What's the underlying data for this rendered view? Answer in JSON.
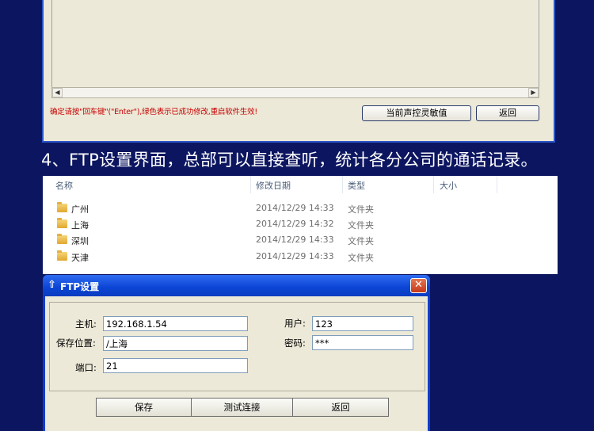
{
  "top_window": {
    "notice_text": "确定请按\"回车键\"(\"Enter\"),绿色表示已成功修改,重启软件生效!",
    "sensitivity_button": "当前声控灵敏值",
    "back_button": "返回"
  },
  "section_heading": "4、FTP设置界面，总部可以直接查听，统计各分公司的通话记录。",
  "explorer": {
    "columns": [
      "名称",
      "修改日期",
      "类型",
      "大小"
    ],
    "rows": [
      {
        "name": "广州",
        "date": "2014/12/29 14:33",
        "type": "文件夹"
      },
      {
        "name": "上海",
        "date": "2014/12/29 14:32",
        "type": "文件夹"
      },
      {
        "name": "深圳",
        "date": "2014/12/29 14:33",
        "type": "文件夹"
      },
      {
        "name": "天津",
        "date": "2014/12/29 14:33",
        "type": "文件夹"
      }
    ]
  },
  "ftp_dialog": {
    "title": "FTP设置",
    "host_label": "主机:",
    "host_value": "192.168.1.54",
    "save_location_label": "保存位置:",
    "save_location_value": "/上海",
    "port_label": "端口:",
    "port_value": "21",
    "user_label": "用户:",
    "user_value": "123",
    "password_label": "密码:",
    "password_value": "***",
    "save_button": "保存",
    "test_button": "测试连接",
    "back_button": "返回"
  }
}
